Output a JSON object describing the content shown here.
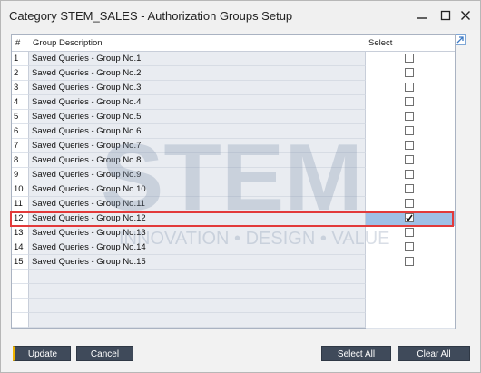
{
  "window": {
    "title": "Category STEM_SALES - Authorization Groups Setup"
  },
  "grid": {
    "columns": [
      "#",
      "Group Description",
      "Select"
    ],
    "rows": [
      {
        "num": "1",
        "desc": "Saved Queries - Group No.1",
        "checked": false
      },
      {
        "num": "2",
        "desc": "Saved Queries - Group No.2",
        "checked": false
      },
      {
        "num": "3",
        "desc": "Saved Queries - Group No.3",
        "checked": false
      },
      {
        "num": "4",
        "desc": "Saved Queries - Group No.4",
        "checked": false
      },
      {
        "num": "5",
        "desc": "Saved Queries - Group No.5",
        "checked": false
      },
      {
        "num": "6",
        "desc": "Saved Queries - Group No.6",
        "checked": false
      },
      {
        "num": "7",
        "desc": "Saved Queries - Group No.7",
        "checked": false
      },
      {
        "num": "8",
        "desc": "Saved Queries - Group No.8",
        "checked": false
      },
      {
        "num": "9",
        "desc": "Saved Queries - Group No.9",
        "checked": false
      },
      {
        "num": "10",
        "desc": "Saved Queries - Group No.10",
        "checked": false
      },
      {
        "num": "11",
        "desc": "Saved Queries - Group No.11",
        "checked": false
      },
      {
        "num": "12",
        "desc": "Saved Queries - Group No.12",
        "checked": true
      },
      {
        "num": "13",
        "desc": "Saved Queries - Group No.13",
        "checked": false
      },
      {
        "num": "14",
        "desc": "Saved Queries - Group No.14",
        "checked": false
      },
      {
        "num": "15",
        "desc": "Saved Queries - Group No.15",
        "checked": false
      }
    ],
    "selected_row": "12"
  },
  "watermark": {
    "brand": "STEM",
    "tagline": "INNOVATION • DESIGN • VALUE"
  },
  "buttons": {
    "update": "Update",
    "cancel": "Cancel",
    "select_all": "Select All",
    "clear_all": "Clear All"
  },
  "colors": {
    "selected_row": "#9fc0e6",
    "highlight_border": "#e23a3a",
    "button_bg": "#3f4a5a",
    "button_accent": "#f0b400"
  }
}
